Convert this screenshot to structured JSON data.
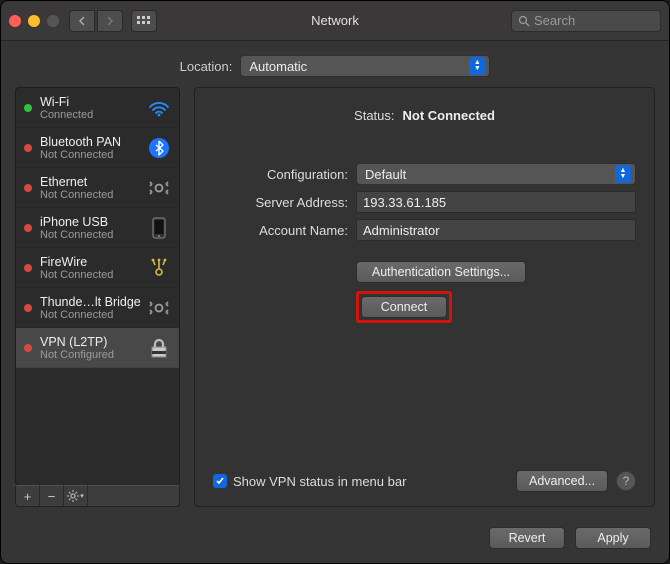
{
  "window": {
    "title": "Network",
    "search_placeholder": "Search"
  },
  "location": {
    "label": "Location:",
    "value": "Automatic"
  },
  "sidebar": {
    "items": [
      {
        "name": "Wi-Fi",
        "status": "Connected",
        "dot": "green",
        "icon": "wifi"
      },
      {
        "name": "Bluetooth PAN",
        "status": "Not Connected",
        "dot": "red",
        "icon": "bluetooth"
      },
      {
        "name": "Ethernet",
        "status": "Not Connected",
        "dot": "red",
        "icon": "ethernet"
      },
      {
        "name": "iPhone USB",
        "status": "Not Connected",
        "dot": "red",
        "icon": "phone"
      },
      {
        "name": "FireWire",
        "status": "Not Connected",
        "dot": "red",
        "icon": "firewire"
      },
      {
        "name": "Thunde…lt Bridge",
        "status": "Not Connected",
        "dot": "red",
        "icon": "ethernet"
      },
      {
        "name": "VPN (L2TP)",
        "status": "Not Configured",
        "dot": "red",
        "icon": "vpn"
      }
    ],
    "selected_index": 6
  },
  "detail": {
    "status_label": "Status:",
    "status_value": "Not Connected",
    "config_label": "Configuration:",
    "config_value": "Default",
    "server_label": "Server Address:",
    "server_value": "193.33.61.185",
    "account_label": "Account Name:",
    "account_value": "Administrator",
    "auth_button": "Authentication Settings...",
    "connect_button": "Connect",
    "show_menubar": "Show VPN status in menu bar",
    "advanced_button": "Advanced..."
  },
  "footer": {
    "revert": "Revert",
    "apply": "Apply"
  }
}
